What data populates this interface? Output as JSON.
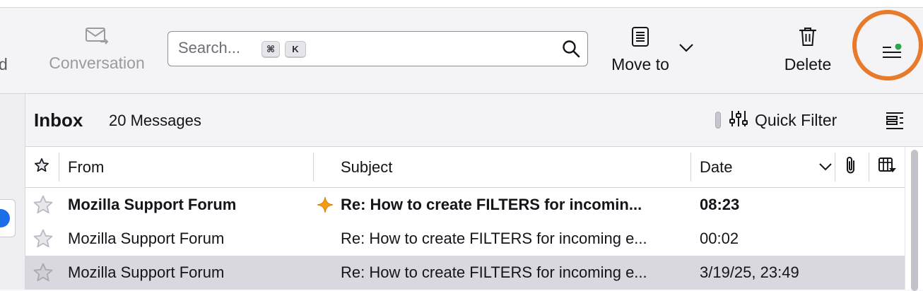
{
  "toolbar": {
    "edge_label": "d",
    "conversation_label": "Conversation",
    "search_placeholder": "Search...",
    "shortcut_keys": [
      "⌘",
      "K"
    ],
    "move_to_label": "Move to",
    "delete_label": "Delete"
  },
  "folder": {
    "title": "Inbox",
    "message_count": "20 Messages",
    "quick_filter_label": "Quick Filter"
  },
  "columns": {
    "from": "From",
    "subject": "Subject",
    "date": "Date"
  },
  "messages": [
    {
      "from": "Mozilla Support Forum",
      "subject": "Re: How to create FILTERS for incomin...",
      "date": "08:23",
      "unread": true,
      "selected": false
    },
    {
      "from": "Mozilla Support Forum",
      "subject": "Re: How to create FILTERS for incoming e...",
      "date": "00:02",
      "unread": false,
      "selected": false
    },
    {
      "from": "Mozilla Support Forum",
      "subject": "Re: How to create FILTERS for incoming e...",
      "date": "3/19/25, 23:49",
      "unread": false,
      "selected": true
    }
  ],
  "colors": {
    "highlight_ring": "#e87a2b",
    "notification_dot": "#2ea44f",
    "new_thread_star": "#f59e0b",
    "selected_row": "#d8d8de"
  }
}
